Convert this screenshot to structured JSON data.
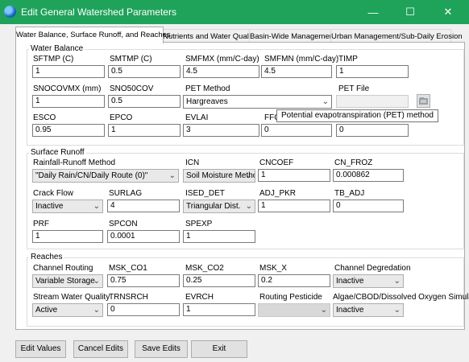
{
  "window": {
    "title": "Edit General Watershed Parameters",
    "minimize": "—",
    "maximize": "☐",
    "close": "✕"
  },
  "tabs": [
    {
      "label": "Water Balance, Surface Runoff, and Reaches"
    },
    {
      "label": "Nutrients and Water Quality"
    },
    {
      "label": "Basin-Wide Management"
    },
    {
      "label": "Urban Management/Sub-Daily Erosion"
    }
  ],
  "water_balance": {
    "title": "Water Balance",
    "sftmp": {
      "label": "SFTMP (C)",
      "value": "1"
    },
    "smtmp": {
      "label": "SMTMP (C)",
      "value": "0.5"
    },
    "smfmx": {
      "label": "SMFMX (mm/C-day)",
      "value": "4.5"
    },
    "smfmn": {
      "label": "SMFMN (mm/C-day)",
      "value": "4.5"
    },
    "timp": {
      "label": "TIMP",
      "value": "1"
    },
    "snocovmx": {
      "label": "SNOCOVMX (mm)",
      "value": "1"
    },
    "sno50cov": {
      "label": "SNO50COV",
      "value": "0.5"
    },
    "pet_method": {
      "label": "PET Method",
      "value": "Hargreaves"
    },
    "pet_file": {
      "label": "PET File",
      "value": ""
    },
    "esco": {
      "label": "ESCO",
      "value": "0.95"
    },
    "epco": {
      "label": "EPCO",
      "value": "1"
    },
    "evlai": {
      "label": "EVLAI",
      "value": "3"
    },
    "ffcb": {
      "label": "FFC",
      "value": "0"
    },
    "extra": {
      "value": "0"
    },
    "tooltip": "Potential evapotranspiration (PET) method"
  },
  "surface_runoff": {
    "title": "Surface Runoff",
    "rainfall_runoff": {
      "label": "Rainfall-Runoff Method",
      "value": "\"Daily Rain/CN/Daily Route (0)\""
    },
    "icn": {
      "label": "ICN",
      "value": "Soil Moisture Metho"
    },
    "cncoef": {
      "label": "CNCOEF",
      "value": "1"
    },
    "cn_froz": {
      "label": "CN_FROZ",
      "value": "0.000862"
    },
    "crack_flow": {
      "label": "Crack Flow",
      "value": "Inactive"
    },
    "surlag": {
      "label": "SURLAG",
      "value": "4"
    },
    "ised_det": {
      "label": "ISED_DET",
      "value": "Triangular Dist."
    },
    "adj_pkr": {
      "label": "ADJ_PKR",
      "value": "1"
    },
    "tb_adj": {
      "label": "TB_ADJ",
      "value": "0"
    },
    "prf": {
      "label": "PRF",
      "value": "1"
    },
    "spcon": {
      "label": "SPCON",
      "value": "0.0001"
    },
    "spexp": {
      "label": "SPEXP",
      "value": "1"
    }
  },
  "reaches": {
    "title": "Reaches",
    "channel_routing": {
      "label": "Channel Routing",
      "value": "Variable Storage"
    },
    "msk_co1": {
      "label": "MSK_CO1",
      "value": "0.75"
    },
    "msk_co2": {
      "label": "MSK_CO2",
      "value": "0.25"
    },
    "msk_x": {
      "label": "MSK_X",
      "value": "0.2"
    },
    "channel_degradation": {
      "label": "Channel Degredation",
      "value": "Inactive"
    },
    "stream_water_quality": {
      "label": "Stream Water Quality",
      "value": "Active"
    },
    "trnsrch": {
      "label": "TRNSRCH",
      "value": "0"
    },
    "evrch": {
      "label": "EVRCH",
      "value": "1"
    },
    "routing_pesticide": {
      "label": "Routing Pesticide",
      "value": ""
    },
    "algae": {
      "label": "Algae/CBOD/Dissolved Oxygen Simulation",
      "value": "Inactive"
    }
  },
  "buttons": {
    "edit": "Edit Values",
    "cancel": "Cancel Edits",
    "save": "Save Edits",
    "exit": "Exit"
  },
  "colors": {
    "titlebar": "#1fa35b",
    "focus": "#0078d7"
  }
}
